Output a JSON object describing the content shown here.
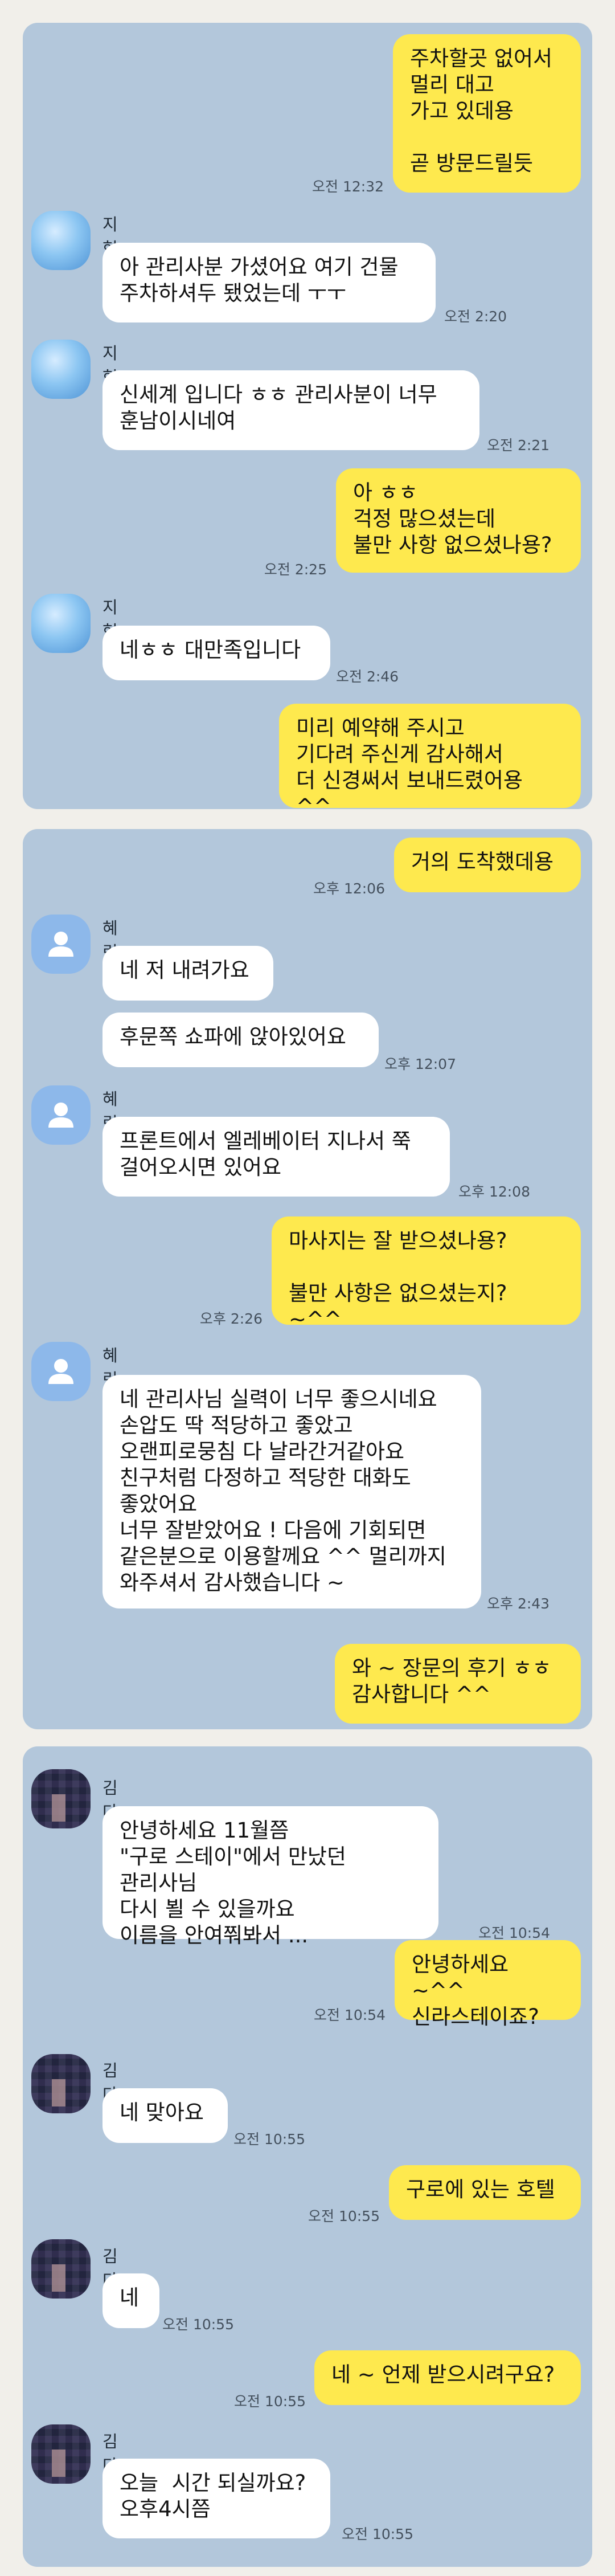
{
  "chats": [
    {
      "messages": [
        {
          "side": "out",
          "text": "주차할곳 없어서\n멀리 대고\n가고 있데용\n\n곧 방문드릴듯",
          "time": "오전 12:32"
        },
        {
          "side": "in",
          "sender": "지현",
          "text": "아 관리사분 가셨어요 여기 건물\n주차하셔두 됐었는데 ㅜㅜ",
          "time": "오전 2:20"
        },
        {
          "side": "in",
          "sender": "지현",
          "text": "신세계 입니다 ㅎㅎ 관리사분이 너무\n훈남이시네여",
          "time": "오전 2:21"
        },
        {
          "side": "out",
          "text": "아 ㅎㅎ\n걱정 많으셨는데\n불만 사항 없으셨나용?",
          "time": "오전 2:25"
        },
        {
          "side": "in",
          "sender": "지현",
          "text": "네ㅎㅎ 대만족입니다",
          "time": "오전 2:46"
        },
        {
          "side": "out",
          "text": "미리 예약해 주시고\n기다려 주신게 감사해서\n더 신경써서 보내드렸어용 ^^",
          "time": ""
        }
      ]
    },
    {
      "messages": [
        {
          "side": "out",
          "text": "거의 도착했데용",
          "time": "오후 12:06"
        },
        {
          "side": "in",
          "sender": "혜린",
          "text": "네 저 내려가요",
          "time": ""
        },
        {
          "side": "in",
          "text": "후문쪽 쇼파에 앉아있어요",
          "time": "오후 12:07"
        },
        {
          "side": "in",
          "sender": "혜린",
          "text": "프론트에서 엘레베이터 지나서 쭉\n걸어오시면 있어요",
          "time": "오후 12:08"
        },
        {
          "side": "out",
          "text": "마사지는 잘 받으셨나용?\n\n불만 사항은 없으셨는지? ~^^",
          "time": "오후 2:26"
        },
        {
          "side": "in",
          "sender": "혜린",
          "text": "네 관리사님 실력이 너무 좋으시네요\n손압도 딱 적당하고 좋았고\n오랜피로뭉침 다 날라간거같아요\n친구처럼 다정하고 적당한 대화도\n좋았어요\n너무 잘받았어요 ! 다음에 기회되면\n같은분으로 이용할께요 ^^ 멀리까지\n와주셔서 감사했습니다 ~",
          "time": "오후 2:43"
        },
        {
          "side": "out",
          "text": "와 ~ 장문의 후기 ㅎㅎ\n감사합니다 ^^",
          "time": ""
        }
      ]
    },
    {
      "messages": [
        {
          "side": "in",
          "sender": "김다은",
          "text": "안녕하세요 11월쯤\n\"구로 스테이\"에서 만났던 관리사님\n다시 뵐 수 있을까요\n이름을 안여쭤봐서 ...",
          "time": "오전 10:54"
        },
        {
          "side": "out",
          "text": "안녕하세요 ~^^\n신라스테이죠?",
          "time": "오전 10:54"
        },
        {
          "side": "in",
          "sender": "김다은",
          "text": "네 맞아요",
          "time": "오전 10:55"
        },
        {
          "side": "out",
          "text": "구로에 있는 호텔",
          "time": "오전 10:55"
        },
        {
          "side": "in",
          "sender": "김다은",
          "text": "네",
          "time": "오전 10:55"
        },
        {
          "side": "out",
          "text": "네 ~ 언제 받으시려구요?",
          "time": "오전 10:55"
        },
        {
          "side": "in",
          "sender": "김다은",
          "text": "오늘  시간 되실까요?\n오후4시쯤",
          "time": "오전 10:55"
        }
      ]
    }
  ]
}
